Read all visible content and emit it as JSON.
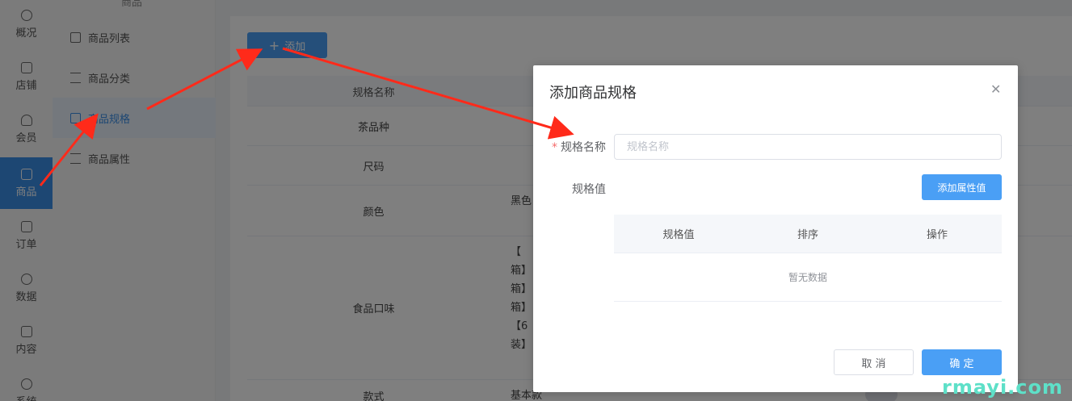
{
  "nav": {
    "items": [
      {
        "label": "概况",
        "icon": "dashboard-icon"
      },
      {
        "label": "店铺",
        "icon": "shop-icon"
      },
      {
        "label": "会员",
        "icon": "user-icon"
      },
      {
        "label": "商品",
        "icon": "goods-icon",
        "active": true
      },
      {
        "label": "订单",
        "icon": "order-icon"
      },
      {
        "label": "数据",
        "icon": "chart-icon"
      },
      {
        "label": "内容",
        "icon": "content-icon"
      },
      {
        "label": "系统",
        "icon": "settings-icon"
      }
    ]
  },
  "submenu": {
    "header": "商品",
    "items": [
      {
        "label": "商品列表",
        "icon": "box-icon"
      },
      {
        "label": "商品分类",
        "icon": "list-icon"
      },
      {
        "label": "商品规格",
        "icon": "copy-icon",
        "active": true
      },
      {
        "label": "商品属性",
        "icon": "sliders-icon"
      }
    ]
  },
  "main": {
    "add_button": "添加",
    "table": {
      "header": "规格名称",
      "rows": [
        {
          "name": "茶品种",
          "value": ""
        },
        {
          "name": "尺码",
          "value": ""
        },
        {
          "name": "颜色",
          "value": "黑色"
        },
        {
          "name": "食品口味",
          "value_lines": [
            "【",
            "箱】",
            "箱】",
            "箱】",
            "【6",
            "装】"
          ]
        },
        {
          "name": "款式",
          "value": "基本款"
        }
      ]
    }
  },
  "dialog": {
    "title": "添加商品规格",
    "close_icon": "close-icon",
    "name_label": "规格名称",
    "name_required_mark": "*",
    "name_placeholder": "规格名称",
    "values_label": "规格值",
    "add_attr_button": "添加属性值",
    "inner_table": {
      "columns": [
        "规格值",
        "排序",
        "操作"
      ],
      "empty_text": "暂无数据"
    },
    "cancel_button": "取 消",
    "ok_button": "确 定"
  },
  "watermark": "rmayi.com",
  "colors": {
    "primary": "#4a9ff5",
    "active_nav": "#3a8ee6",
    "arrow": "#ff2a1a",
    "watermark": "#5ee0c8"
  }
}
